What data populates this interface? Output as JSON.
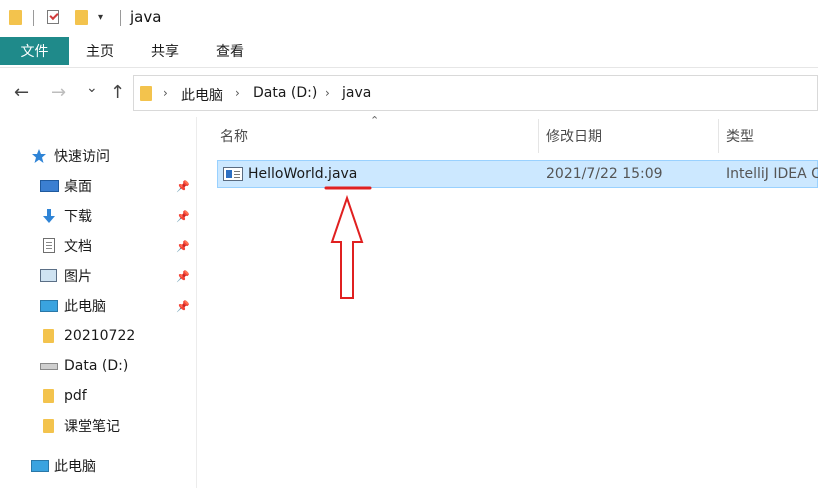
{
  "window": {
    "title": "java",
    "quick_access_dropdown": "▾"
  },
  "ribbon": {
    "tabs": [
      {
        "label": "文件",
        "active": true
      },
      {
        "label": "主页"
      },
      {
        "label": "共享"
      },
      {
        "label": "查看"
      }
    ],
    "accent_color": "#1f8a8a"
  },
  "navigation": {
    "back": "←",
    "forward": "→",
    "recent": "⌄",
    "up": "↑"
  },
  "address_bar": {
    "crumbs": [
      "此电脑",
      "Data (D:)",
      "java"
    ],
    "separator": "›"
  },
  "nav_pane": {
    "quick_access": {
      "label": "快速访问",
      "icon": "star-icon"
    },
    "items": [
      {
        "label": "桌面",
        "icon": "desktop-icon",
        "pinned": true
      },
      {
        "label": "下载",
        "icon": "download-icon",
        "pinned": true
      },
      {
        "label": "文档",
        "icon": "document-icon",
        "pinned": true
      },
      {
        "label": "图片",
        "icon": "picture-icon",
        "pinned": true
      },
      {
        "label": "此电脑",
        "icon": "computer-icon",
        "pinned": true
      },
      {
        "label": "20210722",
        "icon": "folder-icon"
      },
      {
        "label": "Data (D:)",
        "icon": "drive-icon"
      },
      {
        "label": "pdf",
        "icon": "folder-icon"
      },
      {
        "label": "课堂笔记",
        "icon": "folder-icon"
      }
    ],
    "this_pc": {
      "label": "此电脑",
      "icon": "computer-icon"
    },
    "pin_glyph": "📌"
  },
  "file_list": {
    "columns": [
      "名称",
      "修改日期",
      "类型"
    ],
    "rows": [
      {
        "name": "HelloWorld.java",
        "modified": "2021/7/22 15:09",
        "type": "IntelliJ IDEA C",
        "selected": true
      }
    ],
    "selection_color": "#cce8ff"
  },
  "annotation": {
    "color": "#e02020",
    "shape": "underline-and-up-arrow"
  }
}
